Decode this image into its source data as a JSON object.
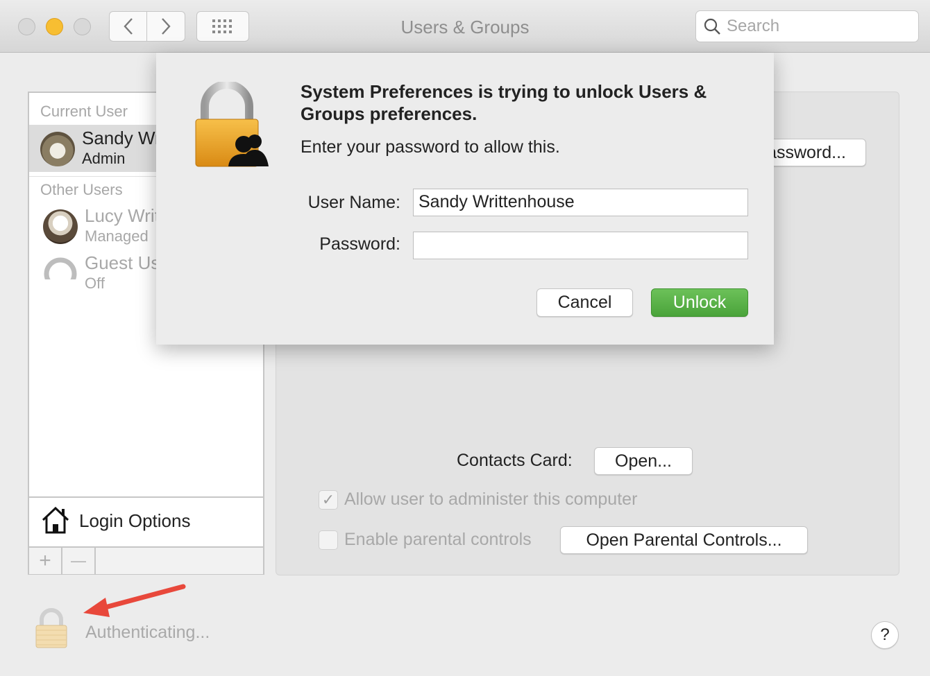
{
  "window": {
    "title": "Users & Groups",
    "search_placeholder": "Search"
  },
  "sidebar": {
    "current_user_label": "Current User",
    "current_user": {
      "name": "Sandy Writtenhouse",
      "role": "Admin"
    },
    "other_users_label": "Other Users",
    "other_users": [
      {
        "name": "Lucy Writtenhouse",
        "role": "Managed"
      },
      {
        "name": "Guest User",
        "role": "Off"
      }
    ],
    "login_options": "Login Options",
    "add_label": "+",
    "remove_label": "—"
  },
  "main": {
    "change_password_label": "Change Password...",
    "contacts_card_label": "Contacts Card:",
    "open_button": "Open...",
    "allow_admin_label": "Allow user to administer this computer",
    "allow_admin_checked": true,
    "parental_controls_label": "Enable parental controls",
    "parental_controls_checked": false,
    "open_parental_controls": "Open Parental Controls..."
  },
  "dialog": {
    "title": "System Preferences is trying to unlock Users & Groups preferences.",
    "message": "Enter your password to allow this.",
    "username_label": "User Name:",
    "username_value": "Sandy Writtenhouse",
    "password_label": "Password:",
    "password_value": "",
    "cancel_label": "Cancel",
    "unlock_label": "Unlock"
  },
  "footer": {
    "status": "Authenticating...",
    "help_label": "?"
  },
  "colors": {
    "unlock_button": "#52a842",
    "annotation_arrow": "#e8483b",
    "minimize": "#f7be32"
  }
}
